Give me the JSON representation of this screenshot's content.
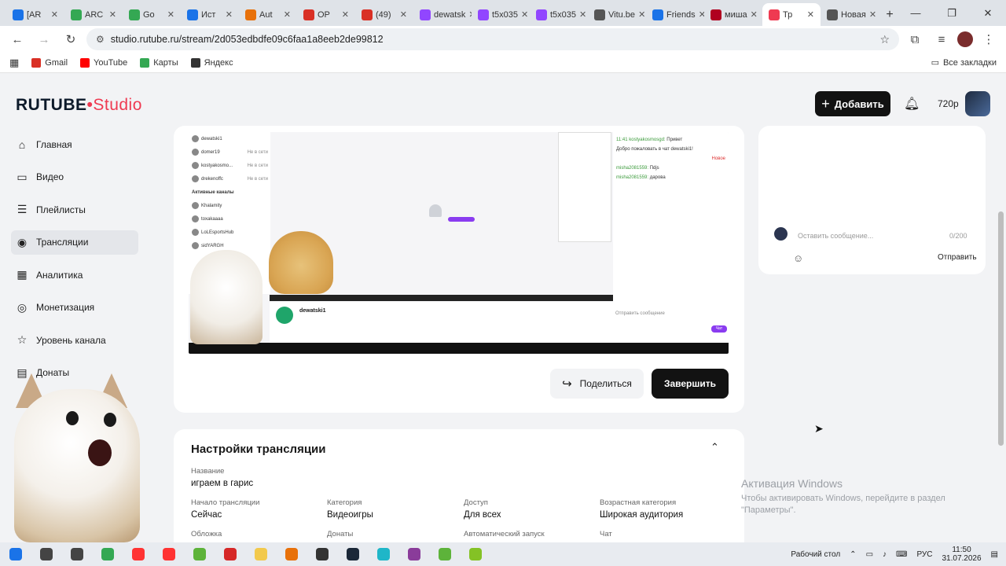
{
  "browser": {
    "tabs": [
      {
        "label": "[AR",
        "color": "#1a73e8"
      },
      {
        "label": "ARC",
        "color": "#34a853"
      },
      {
        "label": "Go",
        "color": "#34a853"
      },
      {
        "label": "Ист",
        "color": "#1a73e8"
      },
      {
        "label": "Aut",
        "color": "#e8710a"
      },
      {
        "label": "OP",
        "color": "#d93025"
      },
      {
        "label": "(49)",
        "color": "#d93025"
      },
      {
        "label": "dewatsk",
        "color": "#9146ff"
      },
      {
        "label": "t5x035",
        "color": "#9146ff"
      },
      {
        "label": "t5x035",
        "color": "#9146ff"
      },
      {
        "label": "Vitu.be",
        "color": "#555555"
      },
      {
        "label": "Friends",
        "color": "#1a73e8"
      },
      {
        "label": "миша",
        "color": "#b00020"
      },
      {
        "label": "Тр",
        "color": "#ef3a51",
        "active": true
      },
      {
        "label": "Новая",
        "color": "#555555"
      }
    ],
    "url": "studio.rutube.ru/stream/2d053edbdfe09c6faa1a8eeb2de99812",
    "bookmarks": [
      {
        "label": "Gmail",
        "color": "#d93025"
      },
      {
        "label": "YouTube",
        "color": "#ff0000"
      },
      {
        "label": "Карты",
        "color": "#34a853"
      },
      {
        "label": "Яндекс",
        "color": "#333333"
      }
    ],
    "all_bookmarks": "Все закладки"
  },
  "header": {
    "logo_main": "RUTUBE",
    "logo_studio": "Studio",
    "add_label": "Добавить",
    "quality": "720p"
  },
  "sidebar": {
    "items": [
      {
        "label": "Главная",
        "icon": "home-icon",
        "glyph": "⌂"
      },
      {
        "label": "Видео",
        "icon": "video-icon",
        "glyph": "▭"
      },
      {
        "label": "Плейлисты",
        "icon": "playlist-icon",
        "glyph": "☰"
      },
      {
        "label": "Трансляции",
        "icon": "broadcast-icon",
        "glyph": "◉",
        "active": true
      },
      {
        "label": "Аналитика",
        "icon": "analytics-icon",
        "glyph": "▦"
      },
      {
        "label": "Монетизация",
        "icon": "money-icon",
        "glyph": "◎"
      },
      {
        "label": "Уровень канала",
        "icon": "star-icon",
        "glyph": "☆"
      },
      {
        "label": "Донаты",
        "icon": "donate-icon",
        "glyph": "▤"
      }
    ]
  },
  "preview": {
    "channels": [
      "dewatski1",
      "domer19",
      "kostyakosmo...",
      "drekenoffc"
    ],
    "status_offline": "Не в сети",
    "active_channels_title": "Активные каналы",
    "active_channels": [
      "Khalamity",
      "toxakaaaa",
      "LoLEsportsHub",
      "sidYARGH"
    ],
    "chat_lines": [
      {
        "user": "11:41 kostyakosmosgd:",
        "text": "Привет"
      },
      {
        "user": "",
        "text": "Добро пожаловать в чат dewatski1!"
      },
      {
        "user": "",
        "text": "Новое"
      },
      {
        "user": "misha2081559:",
        "text": "Пdjs"
      },
      {
        "user": "misha2081559:",
        "text": "дарова"
      }
    ],
    "streamer": "dewatski1",
    "send_placeholder": "Отправить сообщение",
    "chat_button": "Чат"
  },
  "stream_actions": {
    "share_label": "Поделиться",
    "finish_label": "Завершить"
  },
  "settings": {
    "title": "Настройки трансляции",
    "name_label": "Название",
    "name_value": "играем в гарис",
    "fields": [
      {
        "label": "Начало трансляции",
        "value": "Сейчас"
      },
      {
        "label": "Категория",
        "value": "Видеоигры"
      },
      {
        "label": "Доступ",
        "value": "Для всех"
      },
      {
        "label": "Возрастная категория",
        "value": "Широкая аудитория"
      }
    ],
    "row3": [
      "Обложка",
      "Донаты",
      "Автоматический запуск",
      "Чат"
    ]
  },
  "chat": {
    "placeholder": "Оставить сообщение...",
    "counter": "0/200",
    "send_label": "Отправить"
  },
  "windows": {
    "watermark_title": "Активация Windows",
    "watermark_text": "Чтобы активировать Windows, перейдите в раздел \"Параметры\".",
    "desktop_label": "Рабочий стол",
    "lang": "РУС",
    "time": "11:50",
    "date": "31.07.2026"
  },
  "taskbar_icons": [
    {
      "icon": "windows-start-icon",
      "color": "#1a73e8"
    },
    {
      "icon": "search-icon",
      "color": "#444444"
    },
    {
      "icon": "task-view-icon",
      "color": "#444444"
    },
    {
      "icon": "chrome-icon",
      "color": "#34a853"
    },
    {
      "icon": "yandex-icon",
      "color": "#ff3333"
    },
    {
      "icon": "yandex-browser-icon",
      "color": "#ff3333"
    },
    {
      "icon": "utorrent-icon",
      "color": "#5db33a"
    },
    {
      "icon": "media-icon",
      "color": "#d62828"
    },
    {
      "icon": "files-icon",
      "color": "#f2c94c"
    },
    {
      "icon": "app-icon",
      "color": "#e8710a"
    },
    {
      "icon": "obs-icon",
      "color": "#333333"
    },
    {
      "icon": "steam-icon",
      "color": "#1b2838"
    },
    {
      "icon": "vpn-icon",
      "color": "#1fb6c8"
    },
    {
      "icon": "archive-icon",
      "color": "#8a3c9a"
    },
    {
      "icon": "minecraft-icon",
      "color": "#5db33a"
    },
    {
      "icon": "game-icon",
      "color": "#84c225"
    }
  ]
}
